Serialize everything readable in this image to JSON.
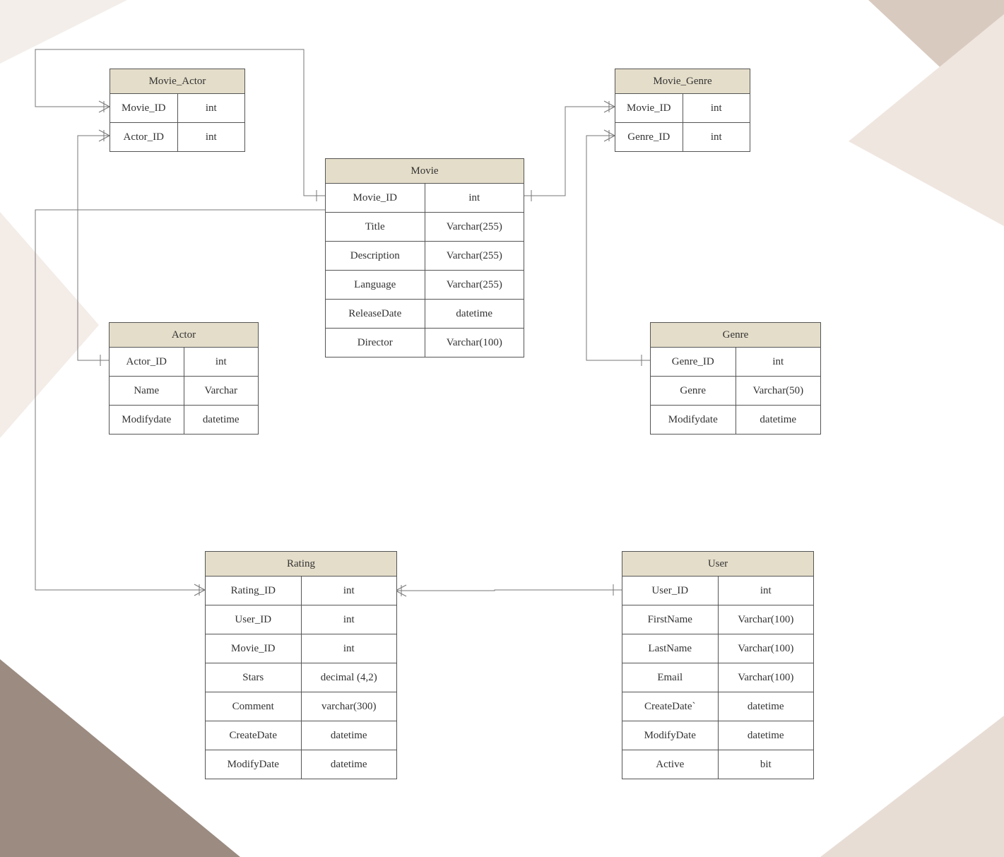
{
  "entities": {
    "movie_actor": {
      "title": "Movie_Actor",
      "rows": [
        {
          "name": "Movie_ID",
          "type": "int"
        },
        {
          "name": "Actor_ID",
          "type": "int"
        }
      ]
    },
    "movie_genre": {
      "title": "Movie_Genre",
      "rows": [
        {
          "name": "Movie_ID",
          "type": "int"
        },
        {
          "name": "Genre_ID",
          "type": "int"
        }
      ]
    },
    "movie": {
      "title": "Movie",
      "rows": [
        {
          "name": "Movie_ID",
          "type": "int"
        },
        {
          "name": "Title",
          "type": "Varchar(255)"
        },
        {
          "name": "Description",
          "type": "Varchar(255)"
        },
        {
          "name": "Language",
          "type": "Varchar(255)"
        },
        {
          "name": "ReleaseDate",
          "type": "datetime"
        },
        {
          "name": "Director",
          "type": "Varchar(100)"
        }
      ]
    },
    "actor": {
      "title": "Actor",
      "rows": [
        {
          "name": "Actor_ID",
          "type": "int"
        },
        {
          "name": "Name",
          "type": "Varchar"
        },
        {
          "name": "Modifydate",
          "type": "datetime"
        }
      ]
    },
    "genre": {
      "title": "Genre",
      "rows": [
        {
          "name": "Genre_ID",
          "type": "int"
        },
        {
          "name": "Genre",
          "type": "Varchar(50)"
        },
        {
          "name": "Modifydate",
          "type": "datetime"
        }
      ]
    },
    "rating": {
      "title": "Rating",
      "rows": [
        {
          "name": "Rating_ID",
          "type": "int"
        },
        {
          "name": "User_ID",
          "type": "int"
        },
        {
          "name": "Movie_ID",
          "type": "int"
        },
        {
          "name": "Stars",
          "type": "decimal (4,2)"
        },
        {
          "name": "Comment",
          "type": "varchar(300)"
        },
        {
          "name": "CreateDate",
          "type": "datetime"
        },
        {
          "name": "ModifyDate",
          "type": "datetime"
        }
      ]
    },
    "user": {
      "title": "User",
      "rows": [
        {
          "name": "User_ID",
          "type": "int"
        },
        {
          "name": "FirstName",
          "type": "Varchar(100)"
        },
        {
          "name": "LastName",
          "type": "Varchar(100)"
        },
        {
          "name": "Email",
          "type": "Varchar(100)"
        },
        {
          "name": "CreateDate`",
          "type": "datetime"
        },
        {
          "name": "ModifyDate",
          "type": "datetime"
        },
        {
          "name": "Active",
          "type": "bit"
        }
      ]
    }
  }
}
